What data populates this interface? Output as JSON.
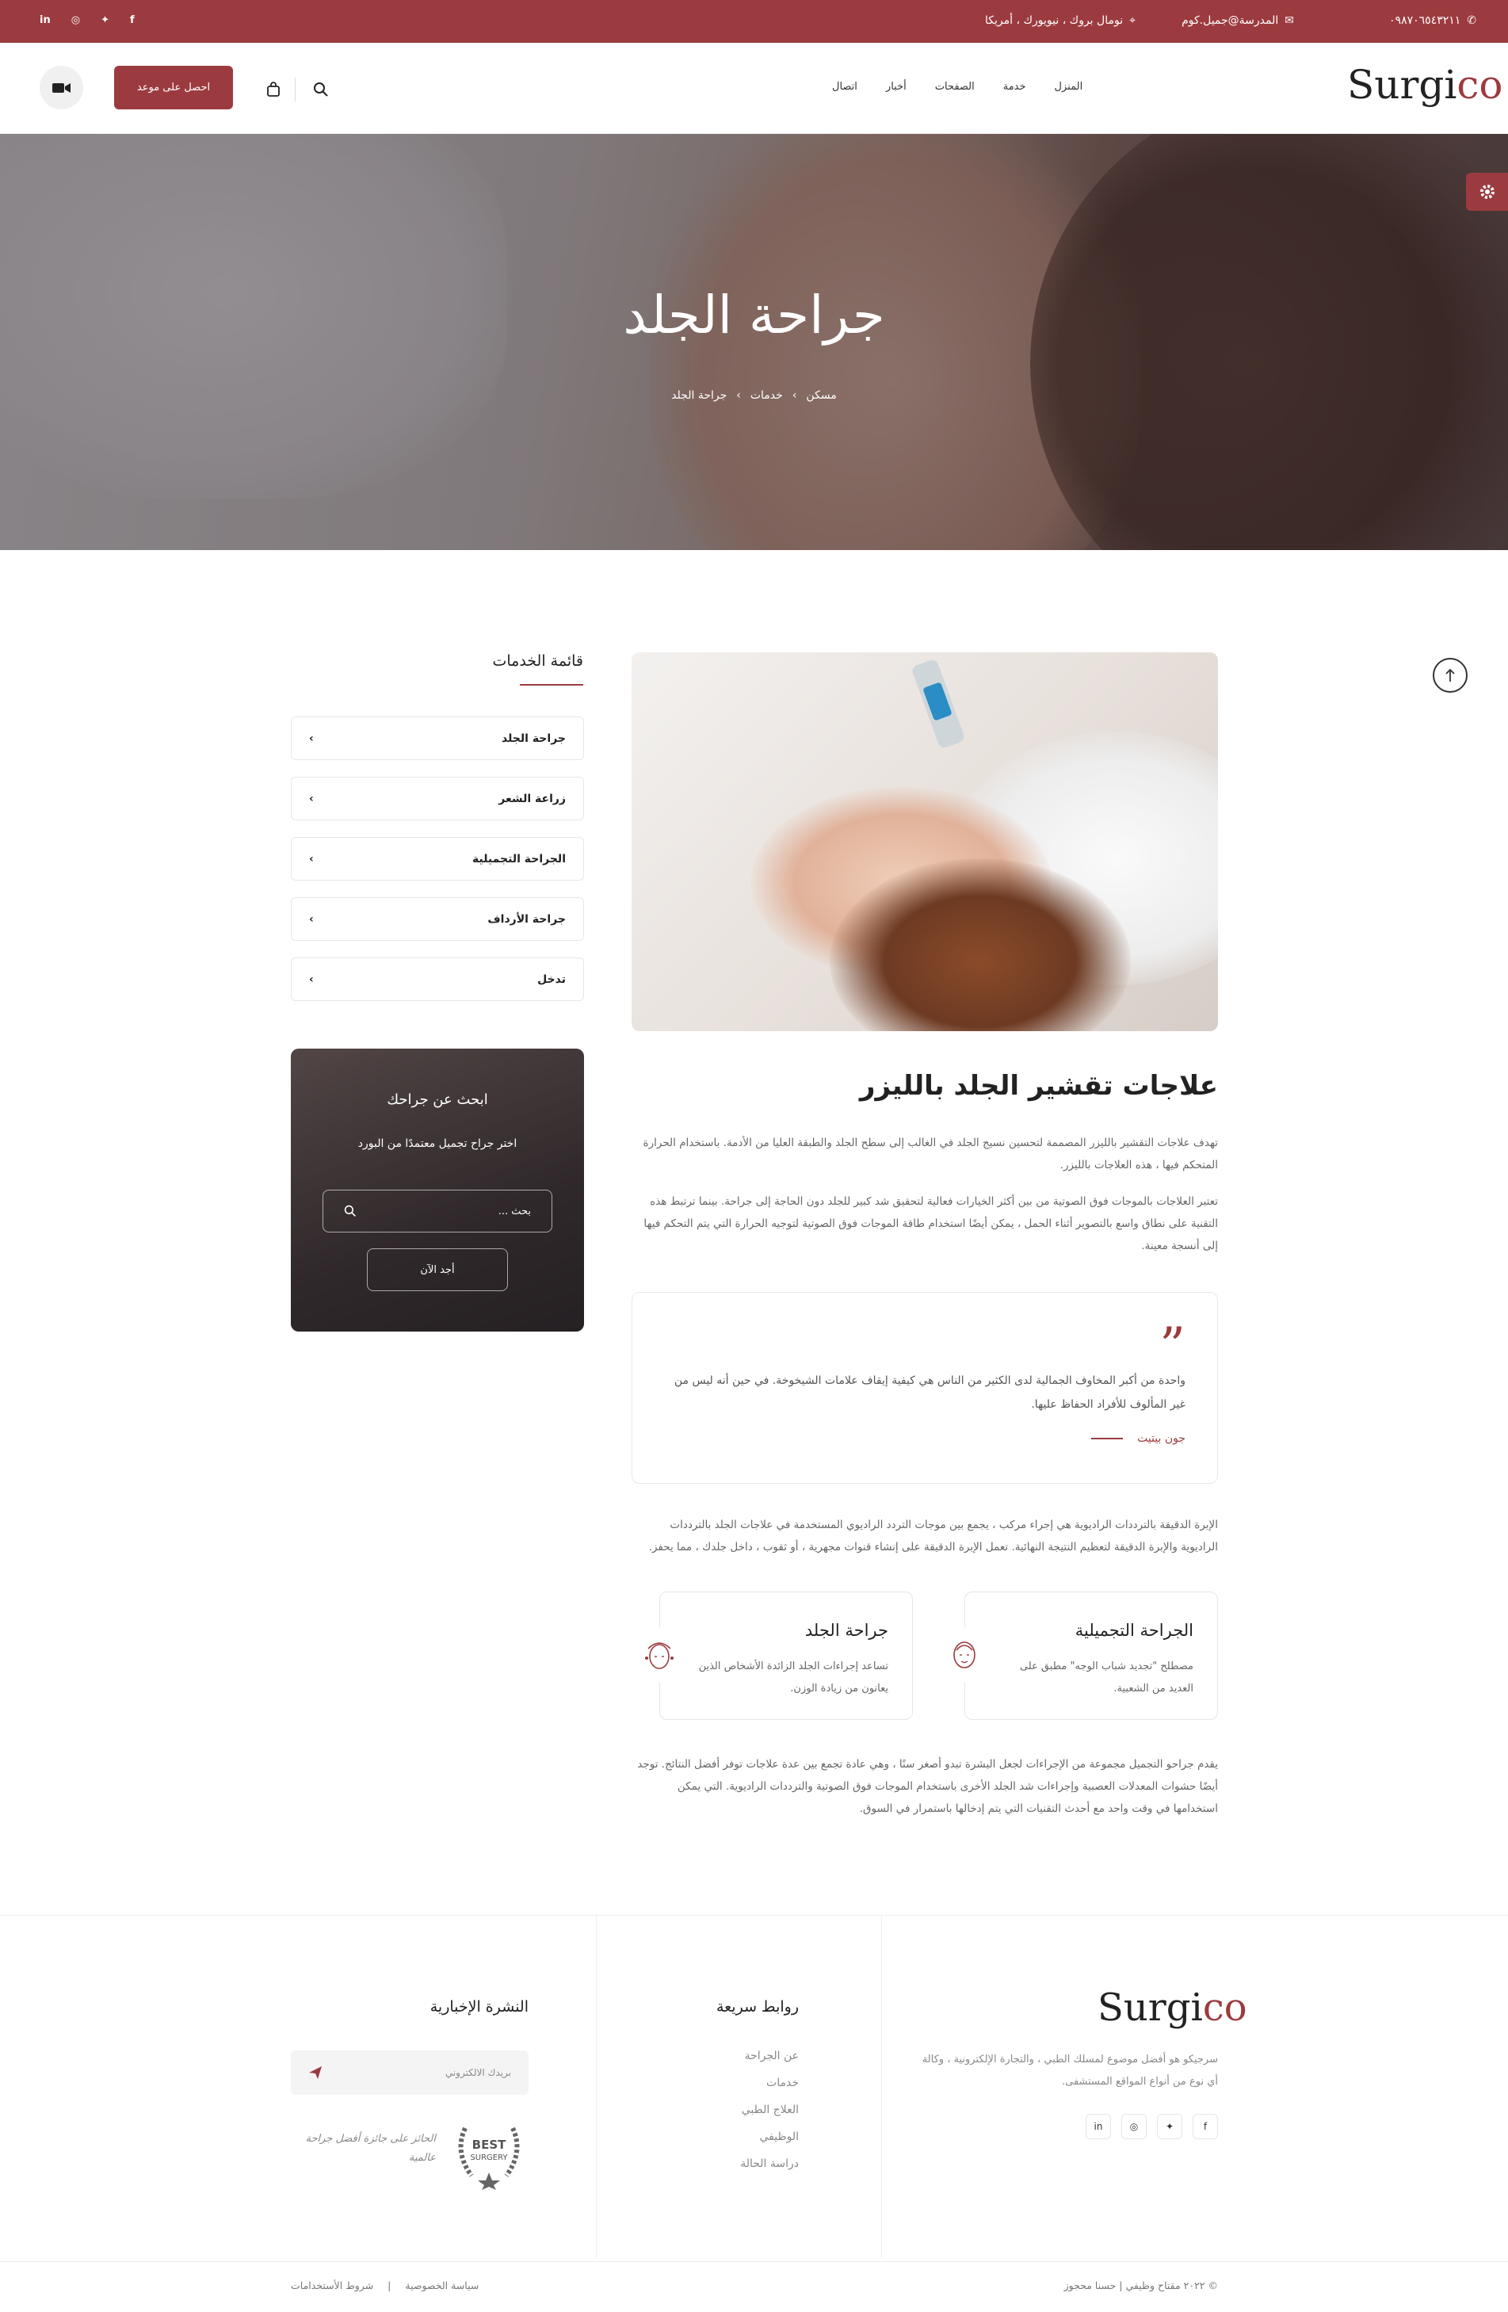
{
  "colors": {
    "accent": "#9c3b3f",
    "text": "#222222",
    "muted": "#666666"
  },
  "topbar": {
    "phone": "٠٩٨٧٠٦٥٤٣٢١١",
    "email": "المدرسة@جميل.كوم",
    "address": "نومال بروك ، نيويورك ، أمريكا",
    "social": [
      "linkedin-icon",
      "instagram-icon",
      "twitter-icon",
      "facebook-icon"
    ],
    "social_glyphs": [
      "in",
      "◎",
      "✦",
      "f"
    ]
  },
  "brand": {
    "part1": "Surgi",
    "part2": "co"
  },
  "nav": {
    "items": [
      "المنزل",
      "خدمة",
      "الصفحات",
      "أخبار",
      "اتصال"
    ]
  },
  "header": {
    "appointment_label": "احصل على موعد"
  },
  "hero": {
    "title": "جراحة الجلد",
    "crumbs": [
      "مسكن",
      "خدمات",
      "جراحة الجلد"
    ],
    "sep": "›"
  },
  "sidebar": {
    "title": "قائمة الخدمات",
    "services": [
      "جراحة الجلد",
      "زراعة الشعر",
      "الجراحة التجميلية",
      "جراحة الأرداف",
      "تدخل"
    ],
    "chevron": "›",
    "search": {
      "title": "ابحث عن جراحك",
      "subtitle": "اختر جراح تجميل معتمدًا من البورد",
      "placeholder": "بحث ...",
      "button": "أجد الآن"
    }
  },
  "content": {
    "heading": "علاجات تقشير الجلد بالليزر",
    "p1": "تهدف علاجات التقشير بالليزر المصممة لتحسين نسيج الجلد في الغالب إلى سطح الجلد والطبقة العليا من الأدمة. باستخدام الحرارة المتحكم فيها ، هذه العلاجات بالليزر.",
    "p2": "تعتبر العلاجات بالموجات فوق الصوتية من بين أكثر الخيارات فعالية لتحقيق شد كبير للجلد دون الحاجة إلى جراحة. بينما ترتبط هذه التقنية على نطاق واسع بالتصوير أثناء الحمل ، يمكن أيضًا استخدام طاقة الموجات فوق الصوتية لتوجيه الحرارة التي يتم التحكم فيها إلى أنسجة معينة.",
    "quote": {
      "mark": "”",
      "text": "واحدة من أكبر المخاوف الجمالية لدى الكثير من الناس هي كيفية إيقاف علامات الشيخوخة. في حين أنه ليس من غير المألوف للأفراد الحفاظ عليها.",
      "author": "جون بيتيت"
    },
    "p3": "الإبرة الدقيقة بالترددات الراديوية هي إجراء مركب ، يجمع بين موجات التردد الراديوي المستخدمة في علاجات الجلد بالترددات الراديوية والإبرة الدقيقة لتعظيم النتيجة النهائية. تعمل الإبرة الدقيقة على إنشاء قنوات مجهرية ، أو ثقوب ، داخل جلدك ، مما يحفز.",
    "features": [
      {
        "title": "الجراحة التجميلية",
        "text": "مصطلح \"تجديد شباب الوجه\" مطبق على العديد من الشعبية.",
        "icon": "face-icon"
      },
      {
        "title": "جراحة الجلد",
        "text": "تساعد إجراءات الجلد الزائدة الأشخاص الذين يعانون من زيادة الوزن.",
        "icon": "face-skin-icon"
      }
    ],
    "p4": "يقدم جراحو التجميل مجموعة من الإجراءات لجعل البشرة تبدو أصغر سنًا ، وهي عادة تجمع بين عدة علاجات توفر أفضل النتائج. توجد أيضًا حشوات المعدلات العصبية وإجراءات شد الجلد الأخرى باستخدام الموجات فوق الصوتية والترددات الراديوية. التي يمكن استخدامها في وقت واحد مع أحدث التقنيات التي يتم إدخالها باستمرار في السوق."
  },
  "footer": {
    "about": "سرجيكو هو أفضل موضوع لمسلك الطبي ، والتجارة الإلكترونية ، وكالة أي نوع من أنواع المواقع المستشفى.",
    "quick_title": "روابط سريعة",
    "links": [
      "عن الجراحة",
      "خدمات",
      "العلاج الطبي",
      "الوظيفي",
      "دراسة الحالة"
    ],
    "news_title": "النشرة الإخبارية",
    "email_placeholder": "بريدك الالكتروني",
    "award": "الحائز على جائزة أفضل جراحة عالمية",
    "badge": {
      "top": "BEST",
      "bottom": "SURGERY"
    },
    "social": [
      "facebook-icon",
      "twitter-icon",
      "instagram-icon",
      "linkedin-icon"
    ],
    "social_glyphs": [
      "f",
      "✦",
      "◎",
      "in"
    ],
    "copyright": "© ٢٠٢٢ مقتاح وظيفي | حسنا محجوز",
    "privacy": "سياسة الخصوصية",
    "terms": "شروط الأستخدامات",
    "sep": "|"
  }
}
